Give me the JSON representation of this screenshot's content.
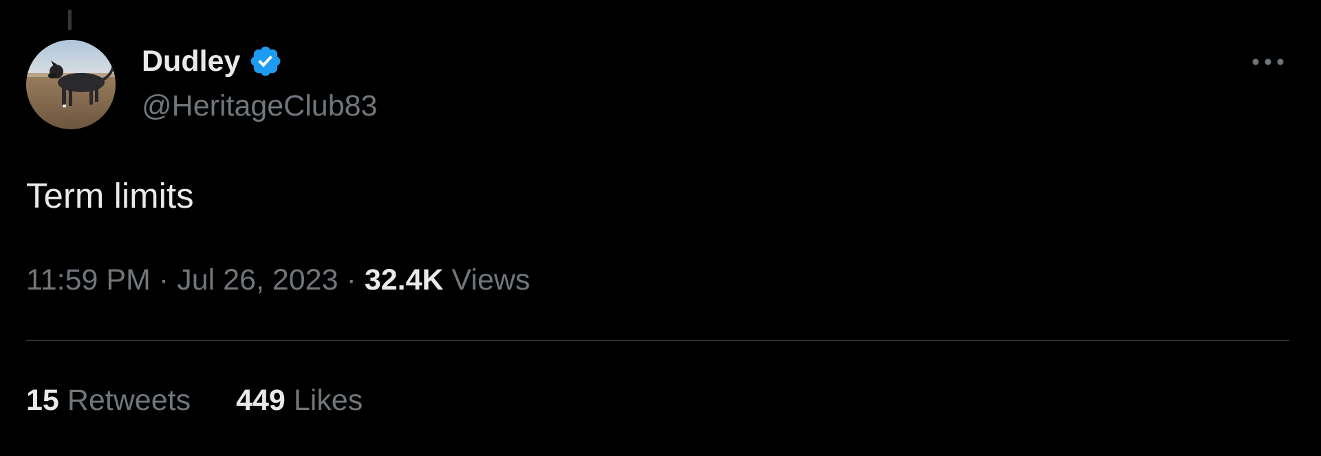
{
  "colors": {
    "background": "#000000",
    "primary_text": "#e7e9ea",
    "secondary_text": "#71767b",
    "verified_badge": "#1d9bf0",
    "divider": "#2f3336"
  },
  "author": {
    "display_name": "Dudley",
    "handle": "@HeritageClub83",
    "verified": true,
    "avatar_icon": "dog-photo-avatar"
  },
  "tweet": {
    "text": "Term limits",
    "time": "11:59 PM",
    "date": "Jul 26, 2023",
    "separator": "·",
    "views_count": "32.4K",
    "views_label": "Views"
  },
  "stats": {
    "retweets_count": "15",
    "retweets_label": "Retweets",
    "likes_count": "449",
    "likes_label": "Likes"
  },
  "menu": {
    "more_icon": "more-horizontal-icon"
  }
}
